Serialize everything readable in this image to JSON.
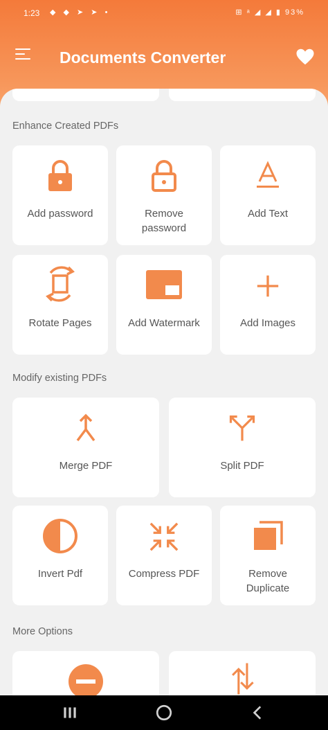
{
  "status_bar": {
    "time": "1:23",
    "left_icons": "◆ ◆ ➤ ➤ •",
    "right_icons": "⊞ ᵃ ◢ ◢ ▮",
    "battery": "93%"
  },
  "app_bar": {
    "title": "Documents Converter",
    "menu_icon": "hamburger-menu-icon",
    "favorite_icon": "heart-icon"
  },
  "colors": {
    "accent": "#F28A4C",
    "header_top": "#f47a3a",
    "header_bottom": "#f9aa72",
    "background": "#f1f1f1",
    "card": "#ffffff"
  },
  "sections": {
    "enhance": {
      "title": "Enhance Created PDFs",
      "items": [
        {
          "label": "Add password",
          "icon": "lock-icon"
        },
        {
          "label": "Remove\npassword",
          "icon": "unlock-icon"
        },
        {
          "label": "Add Text",
          "icon": "text-format-icon"
        },
        {
          "label": "Rotate Pages",
          "icon": "rotate-icon"
        },
        {
          "label": "Add Watermark",
          "icon": "watermark-icon"
        },
        {
          "label": "Add Images",
          "icon": "plus-icon"
        }
      ]
    },
    "modify": {
      "title": "Modify existing PDFs",
      "items": [
        {
          "label": "Merge PDF",
          "icon": "merge-icon"
        },
        {
          "label": "Split PDF",
          "icon": "split-icon"
        },
        {
          "label": "Invert Pdf",
          "icon": "invert-icon"
        },
        {
          "label": "Compress PDF",
          "icon": "compress-icon"
        },
        {
          "label": "Remove\nDuplicate",
          "icon": "duplicate-icon"
        }
      ]
    },
    "more": {
      "title": "More Options",
      "items": [
        {
          "icon": "remove-circle-icon"
        },
        {
          "icon": "swap-vertical-icon"
        }
      ]
    }
  },
  "nav_bar": {
    "recents_icon": "recents-icon",
    "home_icon": "home-icon",
    "back_icon": "back-icon"
  }
}
